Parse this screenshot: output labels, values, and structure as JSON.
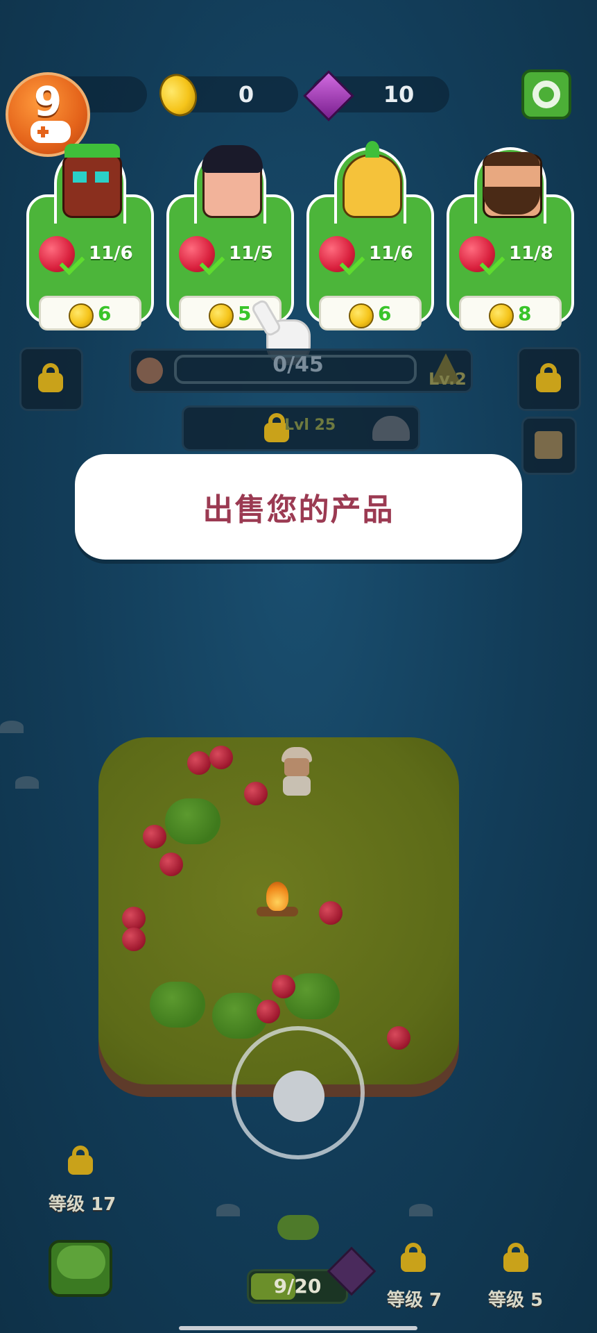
{
  "level_badge": {
    "value": "9"
  },
  "resources": {
    "coins": "0",
    "gems": "10"
  },
  "customers": [
    {
      "name": "tiki-mask",
      "requirement": "11/6",
      "price": "6"
    },
    {
      "name": "curly-hair-guy",
      "requirement": "11/5",
      "price": "5"
    },
    {
      "name": "pineapple-head",
      "requirement": "11/6",
      "price": "6"
    },
    {
      "name": "bearded-man",
      "requirement": "11/8",
      "price": "8"
    }
  ],
  "camp_progress": {
    "text": "0/45",
    "level_tag": "Lv.2"
  },
  "unlock_panel": {
    "text": "Lvl 25"
  },
  "tooltip": {
    "text": "出售您的产品"
  },
  "bottom": {
    "left_lock_label": "等级 17",
    "mid_lock_label": "等级 7",
    "right_lock_label": "等级 5",
    "capacity": "9/20"
  },
  "colors": {
    "card_green": "#4cb53a",
    "price_green": "#39c42a",
    "tooltip_text": "#9b3a52",
    "ocean": "#123c58"
  }
}
